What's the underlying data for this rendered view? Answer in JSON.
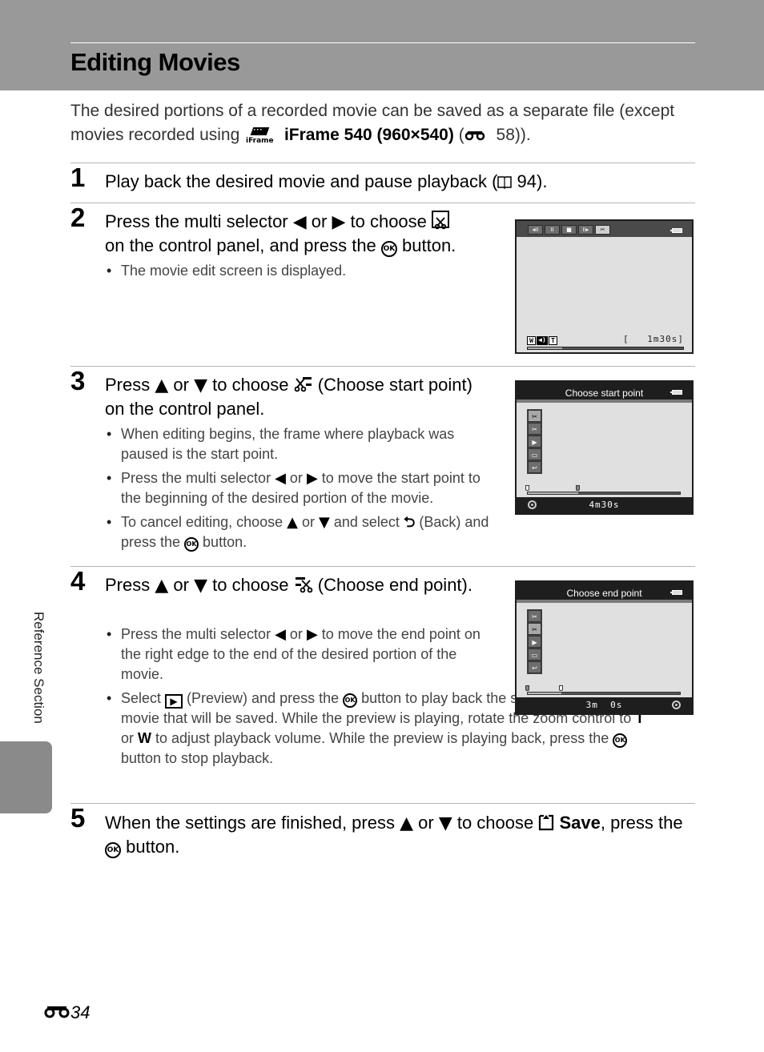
{
  "page": {
    "title": "Editing Movies",
    "intro": {
      "text_before": "The desired portions of a recorded movie can be saved as a separate file (except movies recorded using ",
      "icon": "iframe-icon",
      "bold_text": "iFrame 540 (960×540)",
      "text_after_open": " (",
      "ref_icon": "binoculars-reference-icon",
      "ref_page": " 58",
      "text_after_close": "))."
    },
    "side_tab_label": "Reference Section",
    "page_number": {
      "icon": "binoculars-reference-icon",
      "number": "34"
    }
  },
  "steps": [
    {
      "number": "1",
      "heading": {
        "text": "Play back the desired movie and pause playback (",
        "ref_icon": "book-reference-icon",
        "ref_page": " 94",
        "tail": ")."
      }
    },
    {
      "number": "2",
      "heading": {
        "part1": "Press the multi selector ",
        "left_icon": "◀",
        "or": " or ",
        "right_icon": "▶",
        "part2": " to choose ",
        "edit_icon": "scissors-edit-icon",
        "part3": "on the control panel, and press the ",
        "ok": "OK",
        "part4": " button."
      },
      "bullets": [
        "The movie edit screen is displayed."
      ],
      "screen": {
        "controls": [
          {
            "icon": "rewind-icon",
            "glyph": "◂II"
          },
          {
            "icon": "pause-icon",
            "glyph": "II"
          },
          {
            "icon": "stop-icon",
            "glyph": "■"
          },
          {
            "icon": "forward-icon",
            "glyph": "II▸"
          },
          {
            "icon": "scissors-icon",
            "glyph": "✂",
            "selected": true
          }
        ],
        "volume": {
          "w": "W",
          "t": "T",
          "speaker": "◀)"
        },
        "bracket": "[",
        "time": "1m30s]",
        "progress_fraction": 0.22
      }
    },
    {
      "number": "3",
      "heading": {
        "part1": "Press ",
        "up": "▲",
        "or": " or ",
        "down": "▼",
        "part2": " to choose ",
        "icon": "choose-start-point-icon",
        "part3": " (Choose start point) on the control panel."
      },
      "bullets": [
        {
          "text": "When editing begins, the frame where playback was paused is the start point."
        },
        {
          "a": "Press the multi selector ",
          "left": "◀",
          "or": " or ",
          "right": "▶",
          "b": " to move the start point to the beginning of the desired portion of the movie."
        },
        {
          "a": "To cancel editing, choose ",
          "up": "▲",
          "or": " or ",
          "down": "▼",
          "b": " and select ",
          "back": "⮌",
          "c": " (Back) and press the ",
          "ok": "OK",
          "d": " button."
        }
      ],
      "screen": {
        "title": "Choose start point",
        "menu": [
          {
            "icon": "choose-start-point-icon",
            "glyph": "✂",
            "selected": true
          },
          {
            "icon": "choose-end-point-icon",
            "glyph": "✂"
          },
          {
            "icon": "preview-icon",
            "glyph": "▶"
          },
          {
            "icon": "save-icon",
            "glyph": "▭"
          },
          {
            "icon": "back-icon",
            "glyph": "↩"
          }
        ],
        "start_fraction": 0.0,
        "end_fraction": 0.33,
        "duration": "4m30s"
      }
    },
    {
      "number": "4",
      "heading": {
        "part1": "Press ",
        "up": "▲",
        "or": " or ",
        "down": "▼",
        "part2": " to choose ",
        "icon": "choose-end-point-icon",
        "part3": " (Choose end point)."
      },
      "bullets": [
        {
          "a": "Press the multi selector ",
          "left": "◀",
          "or": " or ",
          "right": "▶",
          "b": " to move the end point on the right edge to the end of the desired portion of the movie."
        },
        {
          "a": "Select ",
          "preview": "▶",
          "b": " (Preview) and press the ",
          "ok": "OK",
          "c": " button to play back the specified portion of the movie that will be saved. While the preview is playing, rotate the zoom control to ",
          "t": "T",
          "or": " or ",
          "w": "W",
          "d": " to adjust playback volume. While the preview is playing back, press the ",
          "ok2": "OK",
          "e": " button to stop playback."
        }
      ],
      "screen": {
        "title": "Choose end point",
        "menu": [
          {
            "icon": "choose-start-point-icon",
            "glyph": "✂"
          },
          {
            "icon": "choose-end-point-icon",
            "glyph": "✂",
            "selected": true
          },
          {
            "icon": "preview-icon",
            "glyph": "▶"
          },
          {
            "icon": "save-icon",
            "glyph": "▭"
          },
          {
            "icon": "back-icon",
            "glyph": "↩"
          }
        ],
        "start_fraction": 0.0,
        "end_fraction": 0.22,
        "duration": "3m  0s"
      }
    },
    {
      "number": "5",
      "heading": {
        "part1": "When the settings are finished, press ",
        "up": "▲",
        "or": " or ",
        "down": "▼",
        "part2": " to choose ",
        "save_icon": "save-icon",
        "save_label": "Save",
        "part3": ", press the ",
        "ok": "OK",
        "part4": " button."
      }
    }
  ]
}
